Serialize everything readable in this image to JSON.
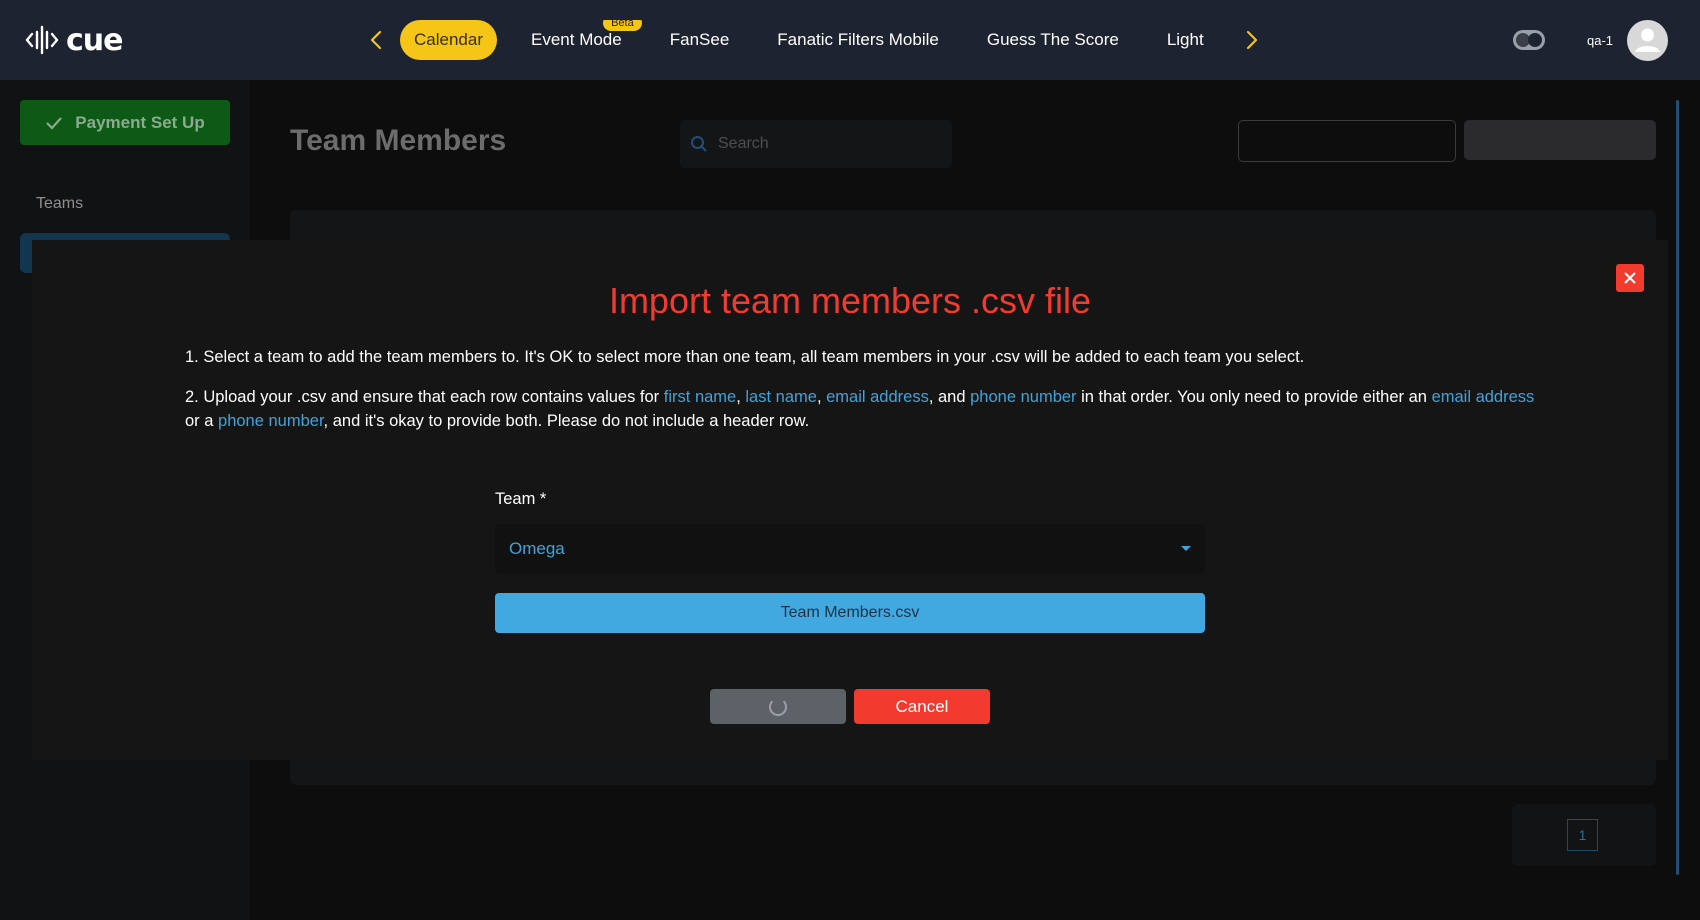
{
  "app": {
    "logo_text": "cue"
  },
  "nav": {
    "items": [
      {
        "label": "Calendar"
      },
      {
        "label": "Event Mode",
        "badge": "Beta"
      },
      {
        "label": "FanSee"
      },
      {
        "label": "Fanatic Filters Mobile"
      },
      {
        "label": "Guess The Score"
      },
      {
        "label": "Light"
      }
    ],
    "accent": "#f5c518"
  },
  "user": {
    "name": "qa-1"
  },
  "sidebar": {
    "payment_label": "Payment Set Up",
    "section_label": "Teams"
  },
  "main": {
    "page_title": "Team Members",
    "search_placeholder": "Search",
    "page_number": "1"
  },
  "modal": {
    "title": "Import team members .csv file",
    "instruction_1": "1. Select a team to add the team members to. It's OK to select more than one team, all team members in your .csv will be added to each team you select.",
    "instruction_2_parts": {
      "p1": "2. Upload your .csv and ensure that each row contains values for ",
      "first_name": "first name",
      "c1": ", ",
      "last_name": "last name",
      "c2": ", ",
      "email_address": "email address",
      "c3": ", and ",
      "phone_number": "phone number",
      "p2": " in that order. You only need to provide either an ",
      "email_address_2": "email address",
      "p3": " or a ",
      "phone_number_2": "phone number",
      "p4": ", and it's okay to provide both. Please do not include a header row."
    },
    "team_label": "Team *",
    "team_value": "Omega",
    "file_label": "Team Members.csv",
    "cancel_label": "Cancel",
    "title_color": "#f23a2f",
    "link_color": "#3fa3dc"
  }
}
